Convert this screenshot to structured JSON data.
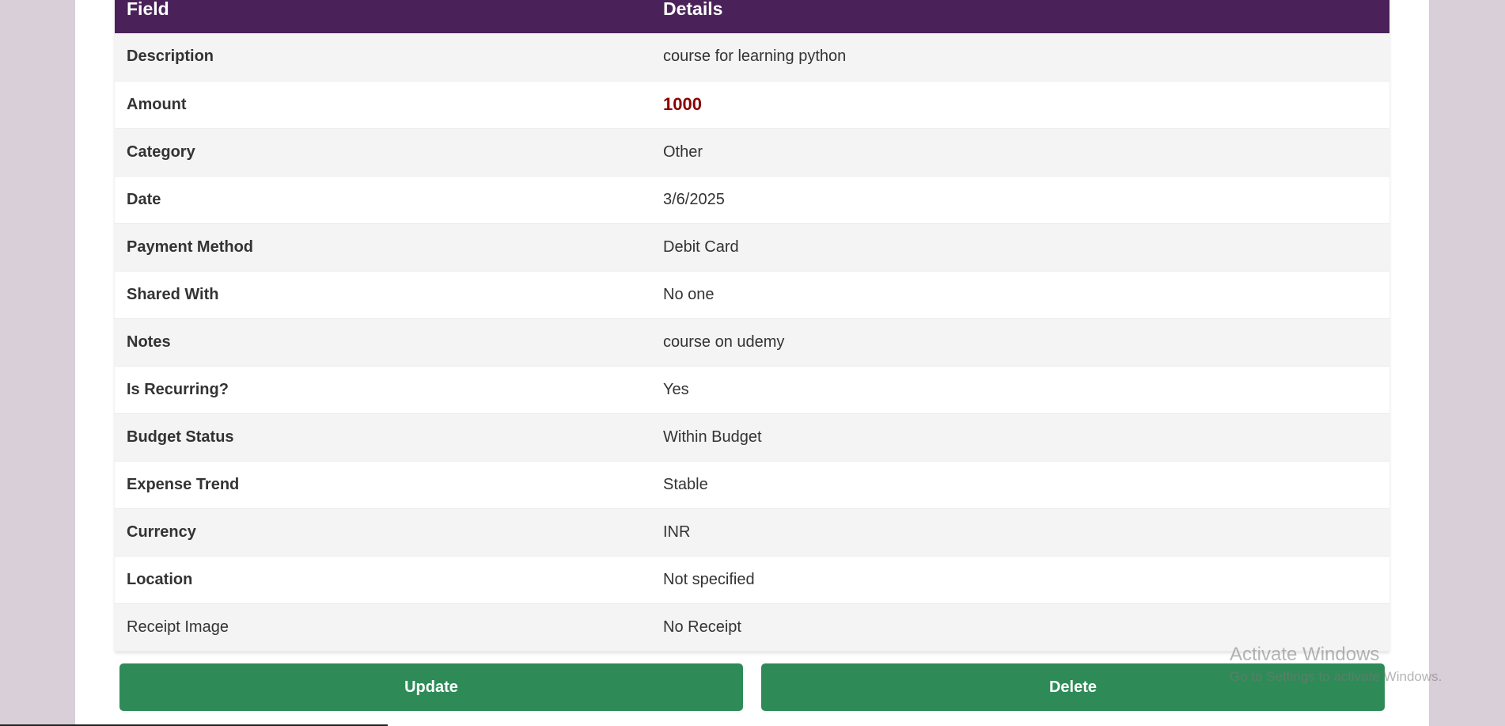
{
  "table": {
    "headers": [
      "Field",
      "Details"
    ],
    "rows": [
      {
        "field": "Description",
        "value": "course for learning python"
      },
      {
        "field": "Amount",
        "value": "1000"
      },
      {
        "field": "Category",
        "value": "Other"
      },
      {
        "field": "Date",
        "value": "3/6/2025"
      },
      {
        "field": "Payment Method",
        "value": "Debit Card"
      },
      {
        "field": "Shared With",
        "value": "No one"
      },
      {
        "field": "Notes",
        "value": "course on udemy"
      },
      {
        "field": "Is Recurring?",
        "value": "Yes"
      },
      {
        "field": "Budget Status",
        "value": "Within Budget"
      },
      {
        "field": "Expense Trend",
        "value": "Stable"
      },
      {
        "field": "Currency",
        "value": "INR"
      },
      {
        "field": "Location",
        "value": "Not specified"
      },
      {
        "field": "Receipt Image",
        "value": "No Receipt"
      }
    ]
  },
  "actions": {
    "update_label": "Update",
    "delete_label": "Delete"
  },
  "watermark": {
    "title": "Activate Windows",
    "subtitle": "Go to Settings to activate Windows."
  },
  "colors": {
    "header_bg": "#4a2159",
    "button_bg": "#2e8b57",
    "amount": "#8b0000",
    "field_label": "#4a1142",
    "page_bg": "#d8cfd8"
  }
}
